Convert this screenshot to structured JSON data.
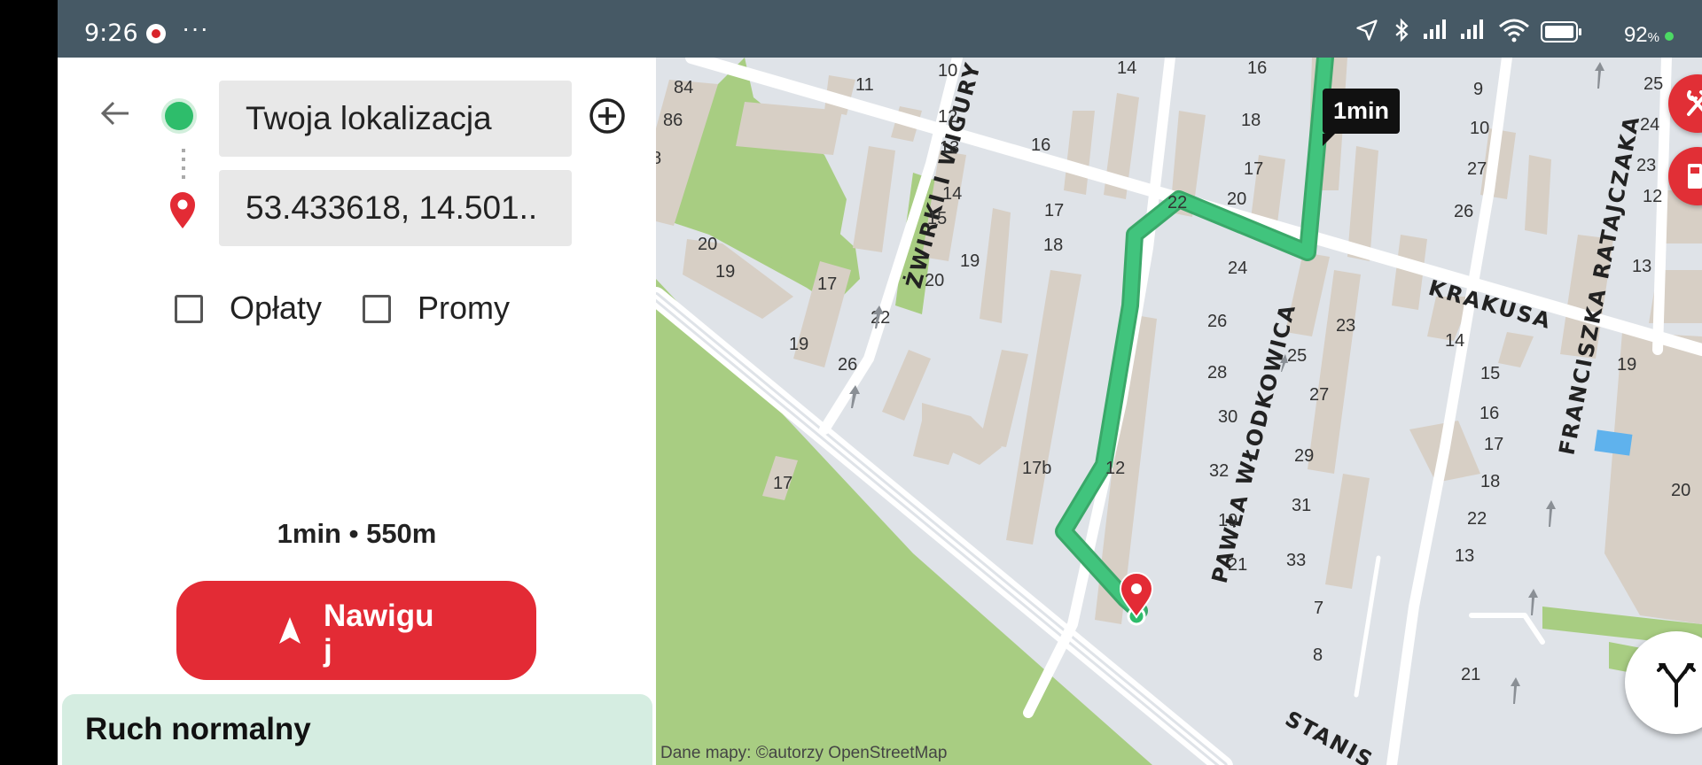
{
  "status": {
    "time": "9:26",
    "overflow": "···",
    "battery": "92",
    "battery_unit": "%"
  },
  "route": {
    "origin": "Twoja lokalizacja",
    "destination": "53.433618, 14.501..",
    "options": [
      {
        "label": "Opłaty",
        "checked": false
      },
      {
        "label": "Promy",
        "checked": false
      }
    ],
    "summary": "1min • 550m",
    "navigate_label": "Nawigu j",
    "traffic": "Ruch normalny"
  },
  "map": {
    "eta_bubble": "1min",
    "attribution": "Dane mapy: ©autorzy OpenStreetMap",
    "street_names": [
      "ŻWIRKI I WIGURY",
      "KRAKUSA",
      "PAWŁA WŁODKOWICA",
      "FRANCISZKA RATAJCZAKA",
      "STANIS"
    ],
    "house_numbers": [
      "84",
      "86",
      "8",
      "11",
      "10",
      "12",
      "13",
      "14",
      "15",
      "16",
      "17",
      "18",
      "19",
      "20",
      "20",
      "19",
      "17",
      "19",
      "22",
      "26",
      "17",
      "17b",
      "12",
      "14",
      "16",
      "18",
      "17",
      "20",
      "22",
      "24",
      "26",
      "28",
      "30",
      "32",
      "19",
      "21",
      "23",
      "25",
      "27",
      "29",
      "31",
      "33",
      "7",
      "8",
      "9",
      "10",
      "27",
      "26",
      "25",
      "24",
      "23",
      "12",
      "13",
      "14",
      "15",
      "16",
      "17",
      "18",
      "22",
      "13",
      "19",
      "20",
      "21"
    ]
  },
  "colors": {
    "route": "#41c47d",
    "accent": "#e32b35",
    "origin": "#2ebd6b",
    "traffic_bg": "#d5ede1",
    "park": "#a8cd82",
    "status_bar": "#465965"
  },
  "icons": [
    "location-arrow-icon",
    "bluetooth-icon",
    "signal-icon",
    "wifi-icon",
    "battery-icon",
    "back-arrow-icon",
    "add-waypoint-icon",
    "destination-pin-icon",
    "navigation-arrow-icon",
    "restaurant-icon",
    "fuel-icon",
    "route-alternatives-icon"
  ]
}
